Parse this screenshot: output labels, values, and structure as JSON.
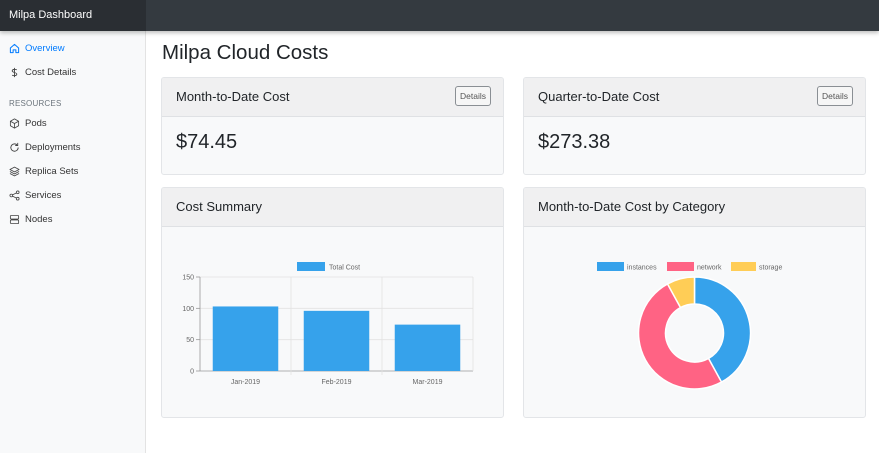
{
  "app": {
    "brand": "Milpa Dashboard"
  },
  "sidebar": {
    "items": [
      {
        "label": "Overview",
        "icon": "home-icon",
        "active": true
      },
      {
        "label": "Cost Details",
        "icon": "dollar-icon",
        "active": false
      }
    ],
    "section_heading": "RESOURCES",
    "resources": [
      {
        "label": "Pods",
        "icon": "cube-icon"
      },
      {
        "label": "Deployments",
        "icon": "refresh-icon"
      },
      {
        "label": "Replica Sets",
        "icon": "layers-icon"
      },
      {
        "label": "Services",
        "icon": "share-icon"
      },
      {
        "label": "Nodes",
        "icon": "server-icon"
      }
    ]
  },
  "page": {
    "title": "Milpa Cloud Costs"
  },
  "cards": {
    "mtd": {
      "title": "Month-to-Date Cost",
      "value": "$74.45",
      "button": "Details"
    },
    "qtd": {
      "title": "Quarter-to-Date Cost",
      "value": "$273.38",
      "button": "Details"
    },
    "summary": {
      "title": "Cost Summary"
    },
    "category": {
      "title": "Month-to-Date Cost by Category"
    }
  },
  "colors": {
    "instances": "#36a2eb",
    "network": "#ff6384",
    "storage": "#ffcd56",
    "brand_active": "#007bff"
  },
  "chart_data": [
    {
      "type": "bar",
      "categories": [
        "Jan-2019",
        "Feb-2019",
        "Mar-2019"
      ],
      "series": [
        {
          "name": "Total Cost",
          "values": [
            103,
            96,
            74
          ]
        }
      ],
      "ylim": [
        0,
        150
      ],
      "yticks": [
        0,
        50,
        100,
        150
      ],
      "grid": true,
      "legend": "top"
    },
    {
      "type": "pie",
      "categories": [
        "instances",
        "network",
        "storage"
      ],
      "values": [
        42,
        50,
        8
      ],
      "legend": "top"
    }
  ]
}
